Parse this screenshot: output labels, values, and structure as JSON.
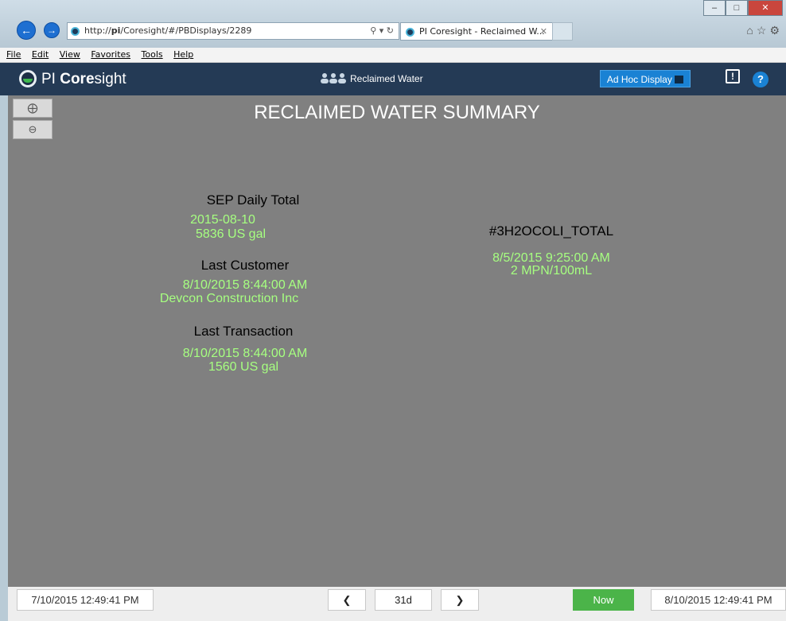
{
  "browser": {
    "url_prefix": "http://",
    "url_host": "pi",
    "url_path": "/Coresight/#/PBDisplays/2289",
    "tab_title": "PI Coresight - Reclaimed W...",
    "menu": [
      "File",
      "Edit",
      "View",
      "Favorites",
      "Tools",
      "Help"
    ]
  },
  "app": {
    "brand_prefix": "PI ",
    "brand_bold": "Core",
    "brand_suffix": "sight",
    "display_name": "Reclaimed Water",
    "adhoc_label": "Ad Hoc Display",
    "help_label": "?"
  },
  "display": {
    "title": "RECLAIMED WATER SUMMARY",
    "sep_label": "SEP Daily Total",
    "sep_date": "2015-08-10",
    "sep_value": "5836 US gal",
    "customer_label": "Last Customer",
    "customer_time": "8/10/2015 8:44:00 AM",
    "customer_name": "Devcon Construction Inc",
    "transaction_label": "Last Transaction",
    "transaction_time": "8/10/2015 8:44:00 AM",
    "transaction_value": "1560 US gal",
    "coli_label": "#3H2OCOLI_TOTAL",
    "coli_time": "8/5/2015 9:25:00 AM",
    "coli_value": "2 MPN/100mL"
  },
  "timebar": {
    "start": "7/10/2015 12:49:41 PM",
    "duration": "31d",
    "now": "Now",
    "end": "8/10/2015 12:49:41 PM"
  },
  "colors": {
    "header": "#243a55",
    "canvas": "#808080",
    "value_green": "#a6ff80",
    "now_green": "#4bb449",
    "accent_blue": "#1a82d4"
  }
}
